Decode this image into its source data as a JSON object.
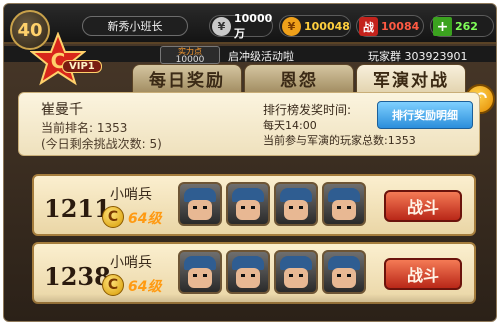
{
  "player": {
    "level": "40",
    "name": "新秀小班长",
    "vip": "VIP1",
    "power_label": "实力点",
    "power_value": "10000"
  },
  "resources": {
    "silver": "10000万",
    "gold": "100048",
    "battle": "10084",
    "hp": "262"
  },
  "subbar": {
    "announcement": "启冲级活动啦",
    "group_label": "玩家群",
    "group_number": "303923901"
  },
  "tabs": [
    {
      "label": "每日奖励"
    },
    {
      "label": "恩怨"
    },
    {
      "label": "军演对战"
    }
  ],
  "panel": {
    "name": "崔曼千",
    "rank_label": "当前排名:",
    "rank_value": "1353",
    "remaining": "(今日剩余挑战次数: 5)",
    "reward_time_label": "排行榜发奖时间:",
    "reward_time_value": "每天14:00",
    "participants_label": "当前参与军演的玩家总数:",
    "participants_value": "1353",
    "detail_button": "排行奖励明细"
  },
  "opponents": [
    {
      "rank": "1211",
      "title": "小哨兵",
      "level": "64级",
      "fight": "战斗"
    },
    {
      "rank": "1238",
      "title": "小哨兵",
      "level": "64级",
      "fight": "战斗"
    }
  ],
  "colors": {
    "gold": "#ffcf3e",
    "battle": "#ff5a43",
    "hp": "#80ff59",
    "fight_button": "#b92718",
    "detail_button": "#2b8edb"
  }
}
